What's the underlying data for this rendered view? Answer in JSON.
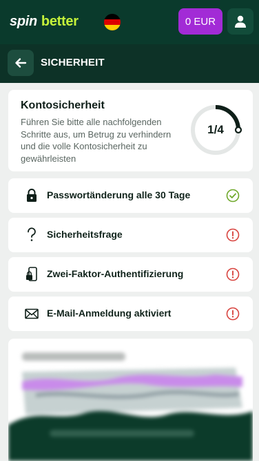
{
  "header": {
    "logo_spin": "spin",
    "logo_better": "better",
    "balance": "0 EUR",
    "flag": "germany-flag",
    "account_icon": "user-icon"
  },
  "section": {
    "title": "SICHERHEIT",
    "back_icon": "arrow-left-icon"
  },
  "summary": {
    "title": "Kontosicherheit",
    "description": "Führen Sie bitte alle nachfolgenden Schritte aus, um Betrug zu verhindern und die volle Kontosicherheit zu gewährleisten",
    "progress_text": "1/4",
    "progress_fraction": 0.25
  },
  "steps": [
    {
      "label": "Passwortänderung alle 30 Tage",
      "icon": "lock-icon",
      "status": "complete"
    },
    {
      "label": "Sicherheitsfrage",
      "icon": "question-icon",
      "status": "warning"
    },
    {
      "label": "Zwei-Faktor-Authentifizierung",
      "icon": "phone-lock-icon",
      "status": "warning"
    },
    {
      "label": "E-Mail-Anmeldung aktiviert",
      "icon": "envelope-icon",
      "status": "warning"
    }
  ],
  "colors": {
    "header_bg": "#0a3a2c",
    "accent_purple": "#a22bd6",
    "brand_green": "#c5f13a",
    "success_green": "#6fa82a",
    "warning_red": "#d8443f"
  }
}
